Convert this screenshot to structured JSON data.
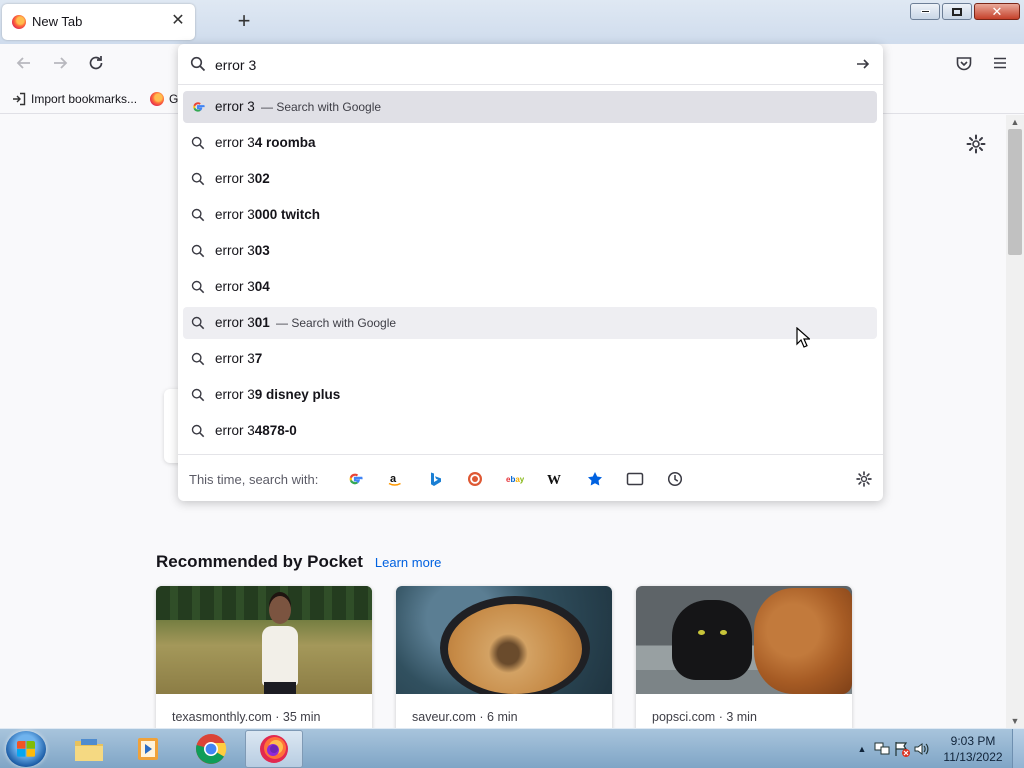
{
  "browser": {
    "tab": {
      "title": "New Tab"
    },
    "bookmarks": [
      {
        "label": "Import bookmarks..."
      },
      {
        "label": "G"
      }
    ]
  },
  "urlbar": {
    "value": "error 3",
    "rows": [
      {
        "typed": "error 3",
        "completion": "",
        "action": "— Search with Google",
        "icon": "google-icon",
        "state": "selected"
      },
      {
        "typed": "error 3",
        "completion": "4 roomba",
        "action": "",
        "icon": "search-icon",
        "state": ""
      },
      {
        "typed": "error 3",
        "completion": "02",
        "action": "",
        "icon": "search-icon",
        "state": ""
      },
      {
        "typed": "error 3",
        "completion": "000 twitch",
        "action": "",
        "icon": "search-icon",
        "state": ""
      },
      {
        "typed": "error 3",
        "completion": "03",
        "action": "",
        "icon": "search-icon",
        "state": ""
      },
      {
        "typed": "error 3",
        "completion": "04",
        "action": "",
        "icon": "search-icon",
        "state": ""
      },
      {
        "typed": "error 3",
        "completion": "01",
        "action": "— Search with Google",
        "icon": "search-icon",
        "state": "hover"
      },
      {
        "typed": "error 3",
        "completion": "7",
        "action": "",
        "icon": "search-icon",
        "state": ""
      },
      {
        "typed": "error 3",
        "completion": "9 disney plus",
        "action": "",
        "icon": "search-icon",
        "state": ""
      },
      {
        "typed": "error 3",
        "completion": "4878-0",
        "action": "",
        "icon": "search-icon",
        "state": ""
      }
    ],
    "one_off": {
      "label": "This time, search with:",
      "engines": [
        "google-engine-icon",
        "amazon-engine-icon",
        "bing-engine-icon",
        "duckduckgo-engine-icon",
        "ebay-engine-icon",
        "wikipedia-engine-icon",
        "bookmarks-icon",
        "tabs-icon",
        "history-icon"
      ]
    }
  },
  "pocket": {
    "heading": "Recommended by Pocket",
    "learn_more": "Learn more",
    "cards": [
      {
        "source": "texasmonthly.com · 35 min"
      },
      {
        "source": "saveur.com · 6 min"
      },
      {
        "source": "popsci.com · 3 min"
      }
    ]
  },
  "taskbar": {
    "time": "9:03 PM",
    "date": "11/13/2022"
  },
  "colors": {
    "accent": "#0061e0",
    "selected_row": "#e0e0e6",
    "taskbar": "#8fb2d2"
  }
}
